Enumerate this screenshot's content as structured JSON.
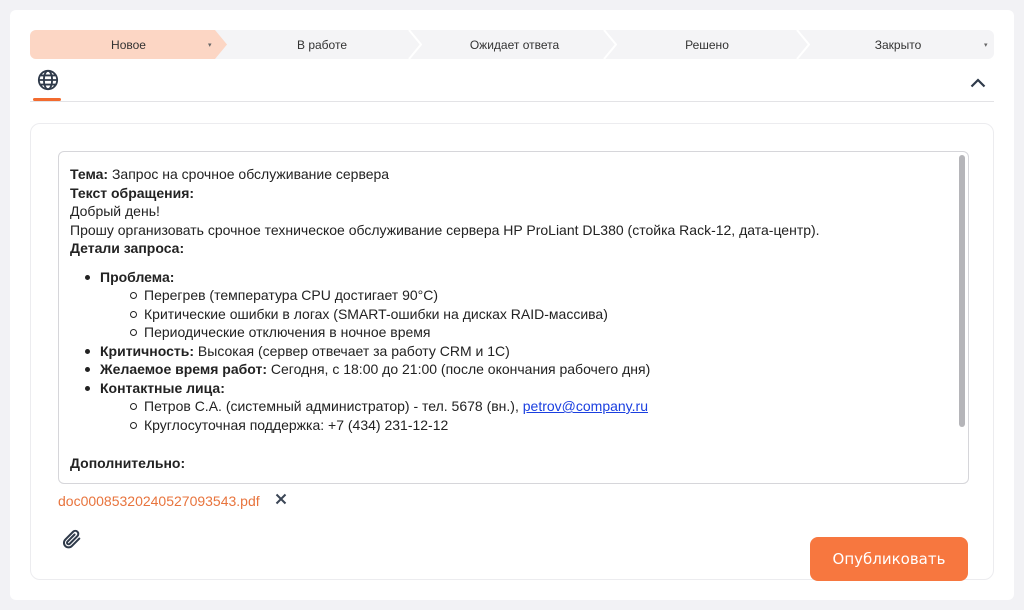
{
  "status_pipeline": {
    "stages": [
      {
        "label": "Новое",
        "active": true
      },
      {
        "label": "В работе",
        "active": false
      },
      {
        "label": "Ожидает ответа",
        "active": false
      },
      {
        "label": "Решено",
        "active": false
      },
      {
        "label": "Закрыто",
        "active": false
      }
    ],
    "active_color": "#fcd6c4"
  },
  "tabs": {
    "active_icon": "globe-icon",
    "collapse_icon": "chevron-up-icon",
    "accent": "#f26b2f"
  },
  "message": {
    "subject_label": "Тема:",
    "subject": "Запрос на срочное обслуживание сервера",
    "body_label": "Текст обращения:",
    "greeting": "Добрый день!",
    "request_line": "Прошу организовать срочное техническое обслуживание сервера HP ProLiant DL380 (стойка Rack-12, дата-центр).",
    "details_label": "Детали запроса:",
    "problem_label": "Проблема:",
    "problems": [
      "Перегрев (температура CPU достигает 90°C)",
      "Критические ошибки в логах (SMART-ошибки на дисках RAID-массива)",
      "Периодические отключения в ночное время"
    ],
    "criticality_label": "Критичность:",
    "criticality": "Высокая (сервер отвечает за работу CRM и 1С)",
    "preferred_time_label": "Желаемое время работ:",
    "preferred_time": "Сегодня, с 18:00 до 21:00 (после окончания рабочего дня)",
    "contacts_label": "Контактные лица:",
    "contact_1_text": "Петров С.А. (системный администратор) - тел. 5678 (вн.),",
    "contact_1_email": "petrov@company.ru",
    "contact_2_text": "Круглосуточная поддержка: +7 (434) 231-12-12",
    "additional_label": "Дополнительно:"
  },
  "attachment": {
    "filename": "doc00085320240527093543.pdf",
    "remove_icon": "close-icon",
    "color": "#e8743d"
  },
  "toolbar": {
    "attach_icon": "paperclip-icon",
    "publish_label": "Опубликовать",
    "publish_color": "#f7773f"
  }
}
